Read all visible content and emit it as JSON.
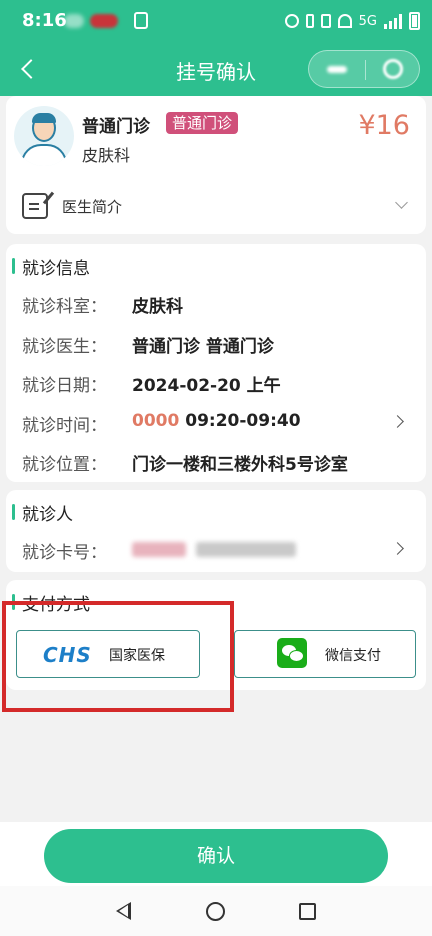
{
  "status_bar": {
    "time": "8:16",
    "signal": "5G"
  },
  "header": {
    "title": "挂号确认"
  },
  "doctor": {
    "name": "普通门诊",
    "tag": "普通门诊",
    "department": "皮肤科",
    "price": "¥16",
    "intro_label": "医生简介"
  },
  "visit_info": {
    "title": "就诊信息",
    "rows": [
      {
        "label": "就诊科室：",
        "value": "皮肤科"
      },
      {
        "label": "就诊医生：",
        "value": "普通门诊 普通门诊"
      },
      {
        "label": "就诊日期：",
        "value": "2024-02-20 上午"
      },
      {
        "label": "就诊时间：",
        "value_highlight": "0000",
        "value": "09:20-09:40"
      },
      {
        "label": "就诊位置：",
        "value": "门诊一楼和三楼外科5号诊室"
      }
    ]
  },
  "patient": {
    "title": "就诊人",
    "card_label": "就诊卡号："
  },
  "payment": {
    "title": "支付方式",
    "options": [
      {
        "logo": "CHS",
        "label": "国家医保"
      },
      {
        "logo": "wechat-pay-icon",
        "label": "微信支付"
      }
    ]
  },
  "footer": {
    "confirm_label": "确认"
  },
  "colors": {
    "primary": "#2dbf8f",
    "price": "#e07a64",
    "tag": "#d0507a",
    "highlight_box": "#d42a2a"
  }
}
